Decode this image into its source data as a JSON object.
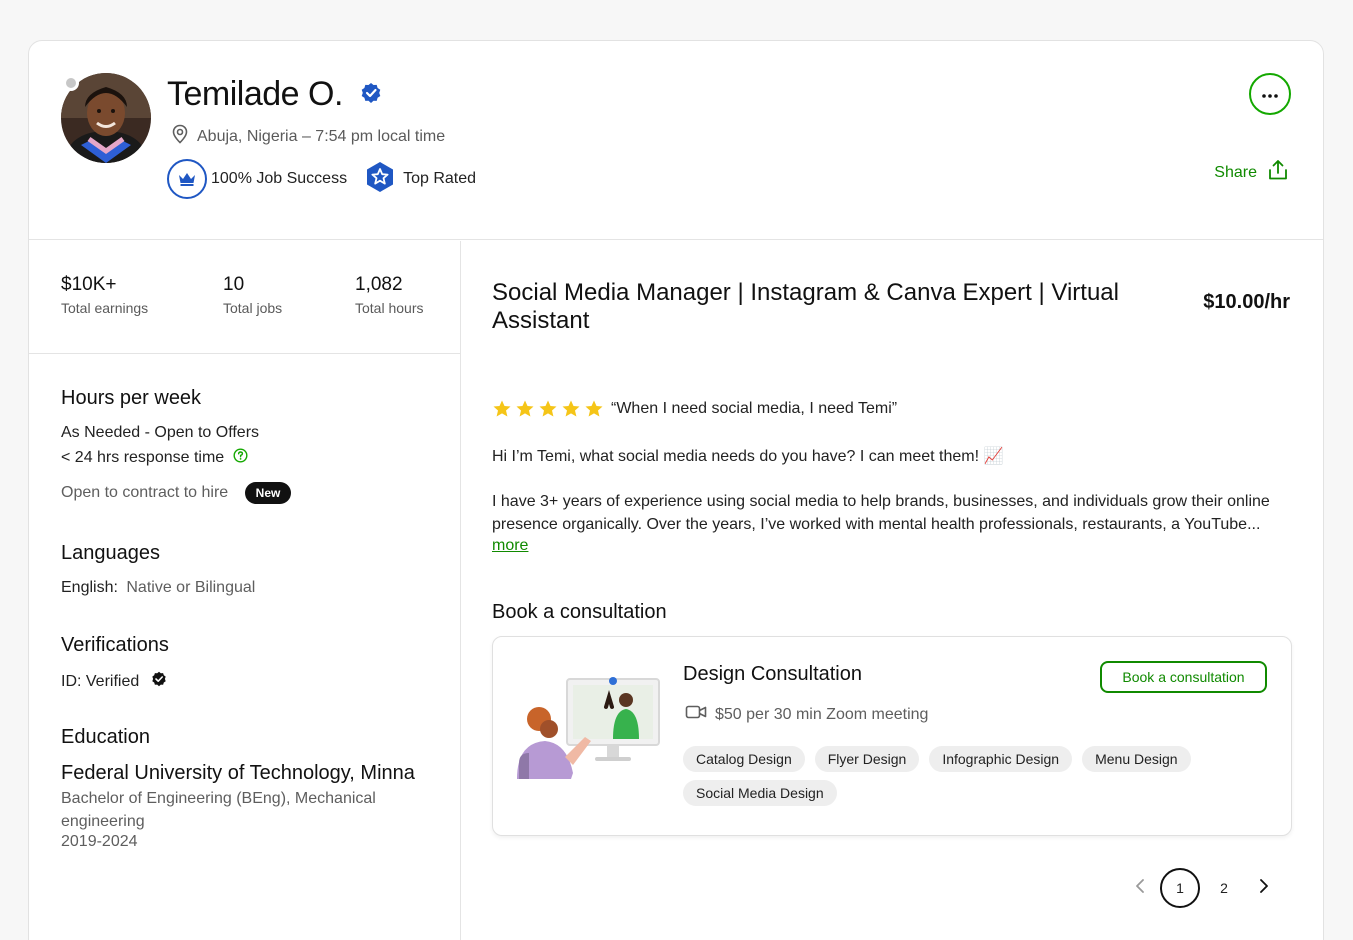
{
  "profile": {
    "name": "Temilade O.",
    "location": "Abuja, Nigeria – 7:54 pm local time",
    "job_success": "100% Job Success",
    "top_rated": "Top Rated",
    "share_label": "Share"
  },
  "stats": [
    {
      "value": "$10K+",
      "label": "Total earnings"
    },
    {
      "value": "10",
      "label": "Total jobs"
    },
    {
      "value": "1,082",
      "label": "Total hours"
    }
  ],
  "sidebar": {
    "hours_title": "Hours per week",
    "hours_value": "As Needed - Open to Offers",
    "response_time": "< 24 hrs response time",
    "open_to_contract": "Open to contract to hire",
    "new_badge": "New",
    "languages_title": "Languages",
    "language_name": "English:",
    "language_level": "Native or Bilingual",
    "verifications_title": "Verifications",
    "id_verified": "ID: Verified",
    "education_title": "Education",
    "school": "Federal University of Technology, Minna",
    "degree": "Bachelor of Engineering (BEng), Mechanical engineering",
    "years": "2019-2024"
  },
  "main": {
    "title": "Social Media Manager | Instagram & Canva Expert | Virtual Assistant",
    "rate": "$10.00/hr",
    "stars": 5,
    "quote": "“When I need social media, I need Temi”",
    "intro": "Hi I’m Temi, what social media needs do you have? I can meet them! 📈",
    "body": "I have 3+ years of experience using social media to help brands, businesses, and individuals grow their online presence organically. Over the years, I’ve worked with mental health professionals, restaurants, a YouTube...",
    "more_link": "more"
  },
  "consultation": {
    "section_title": "Book a consultation",
    "title": "Design Consultation",
    "meta": "$50 per 30 min Zoom meeting",
    "button": "Book a consultation",
    "tags": [
      "Catalog Design",
      "Flyer Design",
      "Infographic Design",
      "Menu Design",
      "Social Media Design"
    ]
  },
  "pagination": {
    "pages": [
      "1",
      "2"
    ],
    "current": "1"
  },
  "colors": {
    "brand_green": "#108a00",
    "badge_blue": "#1f57c3",
    "star_yellow": "#f5c518"
  }
}
